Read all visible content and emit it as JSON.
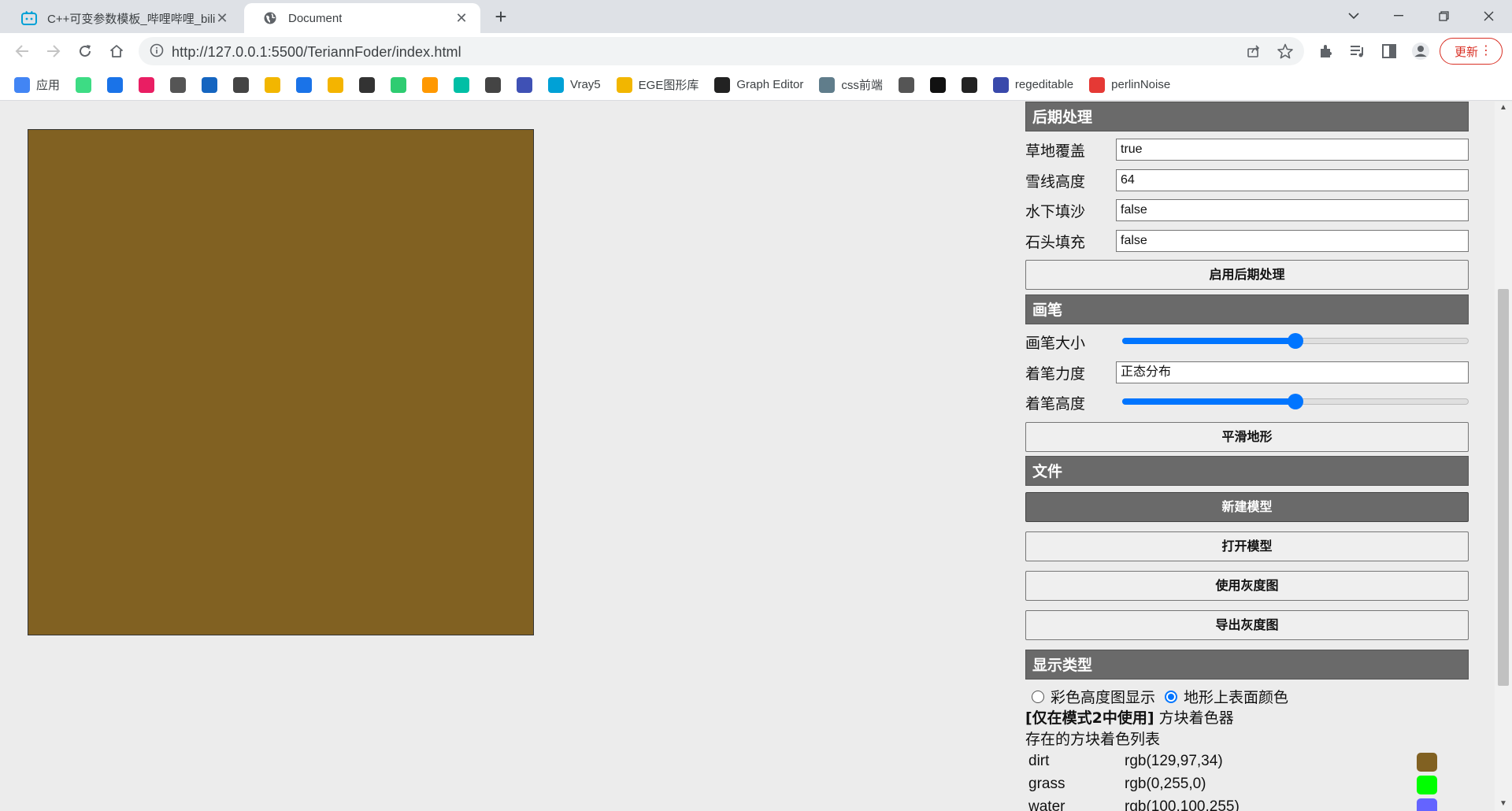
{
  "tabs": [
    {
      "title": "C++可变参数模板_哔哩哔哩_bili",
      "icon": "bilibili-icon",
      "active": false
    },
    {
      "title": "Document",
      "icon": "globe-icon",
      "active": true
    }
  ],
  "toolbar": {
    "url": "http://127.0.0.1:5500/TeriannFoder/index.html",
    "update_label": "更新"
  },
  "bookmarks": [
    {
      "label": "应用",
      "icon": "apps-grid-icon",
      "color": "#4285f4"
    },
    {
      "label": "",
      "icon": "android-icon",
      "color": "#3ddc84"
    },
    {
      "label": "",
      "icon": "runner-icon",
      "color": "#1a73e8"
    },
    {
      "label": "",
      "icon": "pinwheel-icon",
      "color": "#e91e63"
    },
    {
      "label": "",
      "icon": "tools-icon",
      "color": "#555555"
    },
    {
      "label": "",
      "icon": "stickman-icon",
      "color": "#1565c0"
    },
    {
      "label": "",
      "icon": "gear-ring-icon",
      "color": "#444444"
    },
    {
      "label": "",
      "icon": "c-lang-icon",
      "color": "#f2b600"
    },
    {
      "label": "",
      "icon": "q-circle-icon",
      "color": "#1a73e8"
    },
    {
      "label": "",
      "icon": "cup-icon",
      "color": "#f4b400"
    },
    {
      "label": "",
      "icon": "layers-icon",
      "color": "#333333"
    },
    {
      "label": "",
      "icon": "book-icon",
      "color": "#2ecc71"
    },
    {
      "label": "",
      "icon": "grid-orange-icon",
      "color": "#ff9800"
    },
    {
      "label": "",
      "icon": "wave-icon",
      "color": "#00bfa5"
    },
    {
      "label": "",
      "icon": "markdown-icon",
      "color": "#444444"
    },
    {
      "label": "",
      "icon": "edge-icon",
      "color": "#3f51b5"
    },
    {
      "label": "Vray5",
      "icon": "bilibili-icon",
      "color": "#00a1d6"
    },
    {
      "label": "EGE图形库",
      "icon": "duck-icon",
      "color": "#f2b600"
    },
    {
      "label": "Graph Editor",
      "icon": "graph-icon",
      "color": "#222222"
    },
    {
      "label": "css前端",
      "icon": "spinner-icon",
      "color": "#607d8b"
    },
    {
      "label": "",
      "icon": "globe-icon",
      "color": "#555555"
    },
    {
      "label": "",
      "icon": "no-sign-icon",
      "color": "#111111"
    },
    {
      "label": "",
      "icon": "robot-icon",
      "color": "#222222"
    },
    {
      "label": "regeditable",
      "icon": "paw-icon",
      "color": "#3949ab"
    },
    {
      "label": "perlinNoise",
      "icon": "c-red-icon",
      "color": "#e53935"
    }
  ],
  "canvas": {
    "fill_color": "#816122"
  },
  "panel": {
    "postprocess": {
      "header": "后期处理",
      "fields": [
        {
          "label": "草地覆盖",
          "value": "true"
        },
        {
          "label": "雪线高度",
          "value": "64"
        },
        {
          "label": "水下填沙",
          "value": "false"
        },
        {
          "label": "石头填充",
          "value": "false"
        }
      ],
      "apply_button": "启用后期处理"
    },
    "brush": {
      "header": "画笔",
      "size_label": "画笔大小",
      "size_value": 0.5,
      "strength_label": "着笔力度",
      "strength_value": "正态分布",
      "height_label": "着笔高度",
      "height_value": 0.5,
      "smooth_button": "平滑地形"
    },
    "file": {
      "header": "文件",
      "new_button": "新建模型",
      "open_button": "打开模型",
      "use_gray_button": "使用灰度图",
      "export_gray_button": "导出灰度图"
    },
    "display": {
      "header": "显示类型",
      "option_color_height": "彩色高度图显示",
      "option_surface_color": "地形上表面颜色",
      "selected": "地形上表面颜色"
    },
    "colorer": {
      "title_bold": "[仅在模式2中使用]",
      "title_rest": " 方块着色器",
      "subtitle": "存在的方块着色列表",
      "items": [
        {
          "name": "dirt",
          "value": "rgb(129,97,34)",
          "color": "#816122"
        },
        {
          "name": "grass",
          "value": "rgb(0,255,0)",
          "color": "#00ff00"
        },
        {
          "name": "water",
          "value": "rgb(100,100,255)",
          "color": "#6464ff"
        }
      ]
    }
  }
}
